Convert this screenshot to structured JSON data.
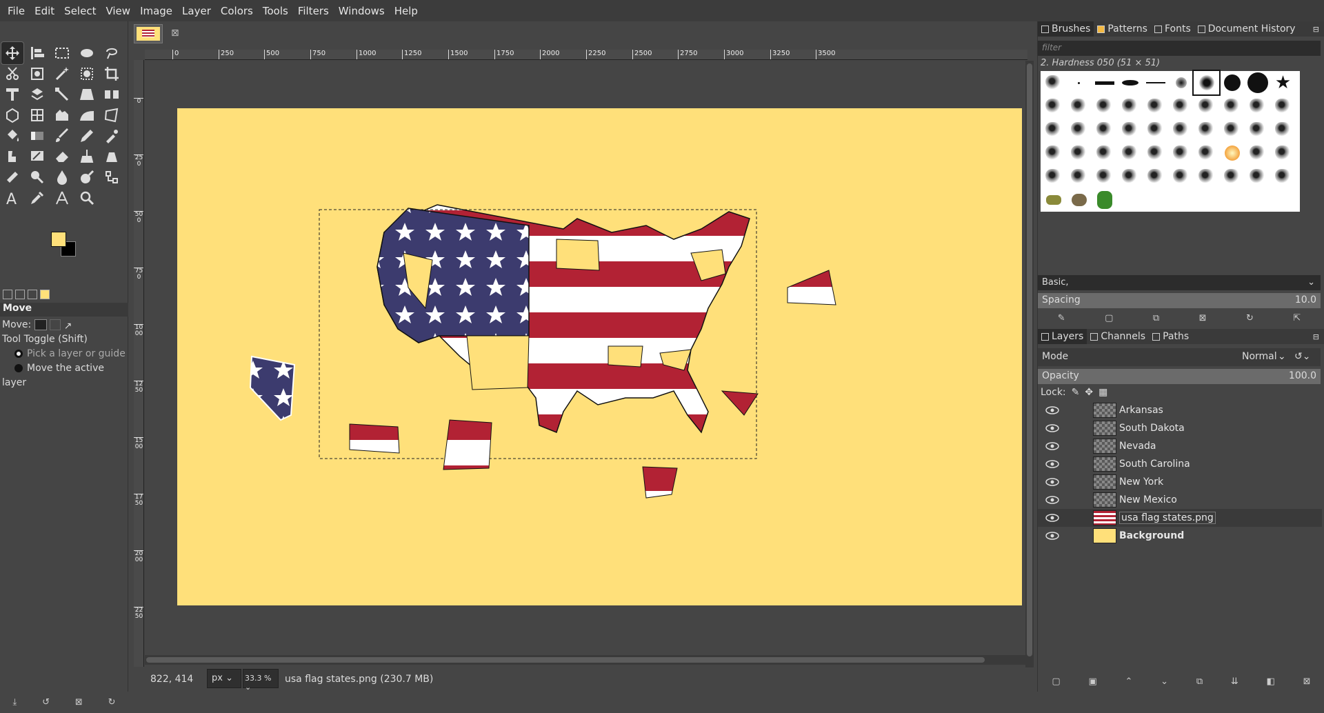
{
  "menu": [
    "File",
    "Edit",
    "Select",
    "View",
    "Image",
    "Layer",
    "Colors",
    "Tools",
    "Filters",
    "Windows",
    "Help"
  ],
  "toolbox": {
    "colors": {
      "foreground": "#ffe07a",
      "background": "#000000"
    },
    "options_title": "Move",
    "move_label": "Move:",
    "tool_toggle": "Tool Toggle  (Shift)",
    "option_pick": "Pick a layer or guide",
    "option_move_active": "Move the active layer"
  },
  "canvas": {
    "ruler_ticks": [
      "0",
      "250",
      "500",
      "750",
      "1000",
      "1250",
      "1500",
      "1750",
      "2000",
      "2250",
      "2500",
      "2750",
      "3000",
      "3250",
      "3500"
    ],
    "vruler_ticks": [
      "0",
      "250",
      "500",
      "750",
      "1000",
      "1250",
      "1500",
      "1750",
      "2000",
      "2250"
    ],
    "image_bg": "#ffe07a",
    "flag_red": "#b22234",
    "flag_blue": "#3c3b6e"
  },
  "status": {
    "coords": "822, 414",
    "unit": "px",
    "zoom": "33.3 %",
    "message": "usa flag states.png (230.7 MB)"
  },
  "dock": {
    "tabs": [
      "Brushes",
      "Patterns",
      "Fonts",
      "Document History"
    ],
    "filter_placeholder": "filter",
    "brush_name": "2. Hardness 050 (51 × 51)",
    "preset": "Basic,",
    "spacing_label": "Spacing",
    "spacing_value": "10.0",
    "layer_tabs": [
      "Layers",
      "Channels",
      "Paths"
    ],
    "mode_label": "Mode",
    "mode_value": "Normal",
    "opacity_label": "Opacity",
    "opacity_value": "100.0",
    "lock_label": "Lock:",
    "layers": [
      {
        "name": "Arkansas",
        "bold": false
      },
      {
        "name": "South Dakota",
        "bold": false
      },
      {
        "name": "Nevada",
        "bold": false
      },
      {
        "name": "South Carolina",
        "bold": false
      },
      {
        "name": "New York",
        "bold": false
      },
      {
        "name": "New Mexico",
        "bold": false
      },
      {
        "name": "usa flag states.png",
        "bold": false
      },
      {
        "name": "Background",
        "bold": true
      }
    ]
  }
}
